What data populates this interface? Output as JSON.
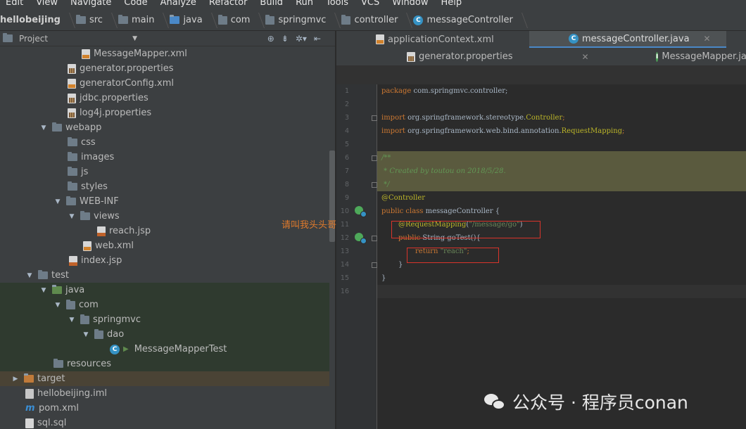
{
  "menu": [
    "Edit",
    "View",
    "Navigate",
    "Code",
    "Analyze",
    "Refactor",
    "Build",
    "Run",
    "Tools",
    "VCS",
    "Window",
    "Help"
  ],
  "breadcrumbs": [
    "hellobeijing",
    "src",
    "main",
    "java",
    "com",
    "springmvc",
    "controller",
    "messageController"
  ],
  "project": {
    "title": "Project",
    "tree": [
      {
        "label": "MessageMapper.xml",
        "icon": "xml-file-icon",
        "depth": 0
      },
      {
        "label": "generator.properties",
        "icon": "properties-file-icon",
        "depth": 0
      },
      {
        "label": "generatorConfig.xml",
        "icon": "xml-file-icon",
        "depth": 0
      },
      {
        "label": "jdbc.properties",
        "icon": "properties-file-icon",
        "depth": 0
      },
      {
        "label": "log4j.properties",
        "icon": "properties-file-icon",
        "depth": 0
      },
      {
        "label": "webapp",
        "icon": "folder-icon",
        "expanded": true
      },
      {
        "label": "css",
        "icon": "folder-icon"
      },
      {
        "label": "images",
        "icon": "folder-icon"
      },
      {
        "label": "js",
        "icon": "folder-icon"
      },
      {
        "label": "styles",
        "icon": "folder-icon"
      },
      {
        "label": "WEB-INF",
        "icon": "folder-icon",
        "expanded": true
      },
      {
        "label": "views",
        "icon": "folder-icon",
        "expanded": true
      },
      {
        "label": "reach.jsp",
        "icon": "jsp-file-icon"
      },
      {
        "label": "web.xml",
        "icon": "xml-file-icon"
      },
      {
        "label": "index.jsp",
        "icon": "jsp-file-icon"
      },
      {
        "label": "test",
        "icon": "folder-icon",
        "expanded": true
      },
      {
        "label": "java",
        "icon": "folder-icon",
        "expanded": true
      },
      {
        "label": "com",
        "icon": "package-icon",
        "expanded": true
      },
      {
        "label": "springmvc",
        "icon": "package-icon",
        "expanded": true
      },
      {
        "label": "dao",
        "icon": "package-icon",
        "expanded": true
      },
      {
        "label": "MessageMapperTest",
        "icon": "class-icon"
      },
      {
        "label": "resources",
        "icon": "folder-icon"
      },
      {
        "label": "target",
        "icon": "folder-icon",
        "expanded": false
      },
      {
        "label": "hellobeijing.iml",
        "icon": "iml-file-icon"
      },
      {
        "label": "pom.xml",
        "icon": "maven-icon"
      },
      {
        "label": "sql.sql",
        "icon": "file-icon"
      }
    ]
  },
  "tabs": {
    "row1": [
      "applicationContext.xml",
      "messageController.java"
    ],
    "row2": [
      "generator.properties",
      "MessageMapper.ja"
    ]
  },
  "code": {
    "line_numbers": [
      "1",
      "2",
      "3",
      "4",
      "5",
      "6",
      "7",
      "8",
      "9",
      "10",
      "11",
      "12",
      "13",
      "14",
      "15",
      "16"
    ],
    "l1_kw": "package",
    "l1_rest": " com.springmvc.controller;",
    "l3_kw": "import",
    "l3_rest": " org.springframework.stereotype.",
    "l3_cls": "Controller",
    "l3_end": ";",
    "l4_kw": "import",
    "l4_rest": " org.springframework.web.bind.annotation.",
    "l4_cls": "RequestMapping",
    "l4_end": ";",
    "l6": "/**",
    "l7": " * Created by toutou on 2018/5/28.",
    "l8": " */",
    "l9": "@Controller",
    "l10_kw": "public class",
    "l10_rest": " messageController {",
    "l11_an": "@RequestMapping",
    "l11_p1": "(",
    "l11_st": "\"/message/go\"",
    "l11_p2": ")",
    "l12_kw": "public",
    "l12_rest": " String goTest(){",
    "l13_kw": "return",
    "l13_st": " \"reach\"",
    "l13_end": ";",
    "l14": "}",
    "l15": "}"
  },
  "overlay": "请叫我头头哥",
  "watermark": "公众号 · 程序员conan"
}
